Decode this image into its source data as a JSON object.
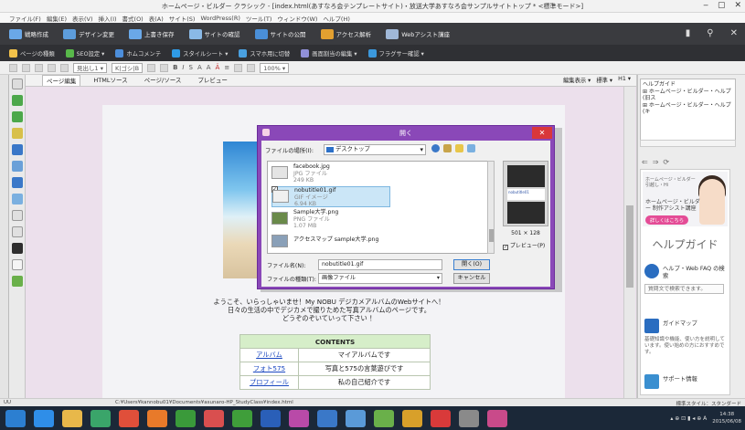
{
  "window": {
    "title": "ホームページ・ビルダー クラシック - [index.html(あすなろ会テンプレートサイト)・放送大学あすなろ会サンプルサイトトップ * <標準モード>]",
    "controls": [
      "‒",
      "▢",
      "✕"
    ]
  },
  "menubar": [
    "ファイル(F)",
    "編集(E)",
    "表示(V)",
    "挿入(I)",
    "書式(O)",
    "表(A)",
    "サイト(S)",
    "WordPress(R)",
    "ツール(T)",
    "ウィンドウ(W)",
    "ヘルプ(H)"
  ],
  "toolbar_main": {
    "items": [
      {
        "label": "戦略作成",
        "color": "#6aa8e8"
      },
      {
        "label": "デザイン変更",
        "color": "#5d9ddc"
      },
      {
        "label": "上書き保存",
        "color": "#6aa8e8"
      },
      {
        "label": "サイトの確認",
        "color": "#8ab9e6"
      },
      {
        "label": "サイトの公開",
        "color": "#4a8fd8"
      },
      {
        "label": "アクセス解析",
        "color": "#e3a030"
      },
      {
        "label": "Webアシスト講座",
        "color": "#a0b8d8"
      }
    ],
    "right_icons": [
      "▮",
      "⚲",
      "✕"
    ]
  },
  "toolbar_sub": {
    "items": [
      {
        "label": "ページの種類",
        "color": "#f1c14a"
      },
      {
        "label": "SEO設定 ▾",
        "color": "#58b84a"
      },
      {
        "label": "ホムコメンテ",
        "color": "#4c8edb"
      },
      {
        "label": "スタイルシート ▾",
        "color": "#2f9be6"
      },
      {
        "label": "スマホ用に切替",
        "color": "#49a0e0"
      },
      {
        "label": "画面割当の編集 ▾",
        "color": "#9090d8"
      },
      {
        "label": "フラグサー確認 ▾",
        "color": "#3b98dc"
      }
    ]
  },
  "format_bar": {
    "paragraph": "見出し1 ▾",
    "font": "K|ゴシ|B",
    "zoom": "100% ▾",
    "style_glyphs": [
      "B",
      "I",
      "S",
      "A",
      "A",
      "Ä",
      "≡"
    ]
  },
  "edit_tabs": {
    "tabs": [
      "ページ編集",
      "HTMLソース",
      "ページ/ソース",
      "プレビュー"
    ],
    "right": [
      "編集表示 ▾",
      "標準 ▾",
      "H1 ▾"
    ]
  },
  "page": {
    "welcome_lines": [
      "ようこそ、いらっしゃいませ！My NOBU デジカメアルバムのWebサイトへ！",
      "日々の生活の中でデジカメで撮りためた写真アルバムのページです。",
      "どうぞのぞいていって下さい ！"
    ],
    "contents_header": "CONTENTS",
    "contents_rows": [
      {
        "link": "アルバム",
        "desc": "マイアルバムです"
      },
      {
        "link": "フォト575",
        "desc": "写真と575の言葉遊びです"
      },
      {
        "link": "プロフィール",
        "desc": "私の自己紹介です"
      }
    ]
  },
  "dialog": {
    "title": "開く",
    "close": "✕",
    "look_in_label": "ファイルの場所(I):",
    "look_in_value": "デスクトップ",
    "files": [
      {
        "name": "facebook.jpg",
        "type": "JPG ファイル",
        "size": "249 KB",
        "selected": false,
        "checked": false
      },
      {
        "name": "nobutitle01.gif",
        "type": "GIF イメージ",
        "size": "6.94 KB",
        "selected": true,
        "checked": true
      },
      {
        "name": "Sample大学.png",
        "type": "PNG ファイル",
        "size": "1.07 MB",
        "selected": false,
        "checked": false
      },
      {
        "name": "アクセスマップ sample大学.png",
        "type": "",
        "size": "",
        "selected": false,
        "checked": false
      }
    ],
    "preview_size": "501 × 128",
    "preview_check_label": "プレビュー(P)",
    "preview_text": "nobutitle01",
    "filename_label": "ファイル名(N):",
    "filename_value": "nobutitle01.gif",
    "filetype_label": "ファイルの種類(T):",
    "filetype_value": "画像ファイル",
    "open_button": "開く(O)",
    "cancel_button": "キャンセル"
  },
  "right_panel": {
    "tree_lines": [
      "ヘルプガイド",
      "⊞ ホームページ・ビルダー・ヘルプ(旧ス",
      "⊞ ホームページ・ビルダー・ヘルプ(キ"
    ],
    "nav": [
      "⇐",
      "⇒",
      "⟳"
    ],
    "banner_small": "ホームページ・ビルダー 引越し・Hi",
    "banner_main": "ホームページ・ビルダー 制作アシスト講座",
    "banner_button": "詳しくはこちら",
    "help_title": "ヘルプガイド",
    "sections": [
      {
        "label": "ヘルプ・Web FAQ の検索",
        "box": "質問文で検索できます。",
        "color": "#2a6dc0"
      },
      {
        "label": "ガイドマップ",
        "desc": "基礎知識や機能、使い方を説明しています。使い始めの方におすすめです。",
        "color": "#2a6dc0"
      },
      {
        "label": "サポート情報",
        "color": "#3a8fd0"
      }
    ]
  },
  "statusbar": {
    "left": "UU",
    "path": "C:¥Users¥kannobu01¥Documents¥asunaro-HP_StudyClass¥index.html",
    "mode": "標準スタイル：スタンダード"
  },
  "taskbar": {
    "apps": [
      {
        "name": "start",
        "color": "#2c7fd1"
      },
      {
        "name": "ie",
        "color": "#2f8ee8"
      },
      {
        "name": "explorer",
        "color": "#e8b84a"
      },
      {
        "name": "store",
        "color": "#3aa56a"
      },
      {
        "name": "media",
        "color": "#e04f3a"
      },
      {
        "name": "firefox",
        "color": "#e87a2a"
      },
      {
        "name": "chrome",
        "color": "#3a9a3a"
      },
      {
        "name": "tool1",
        "color": "#d94f4f"
      },
      {
        "name": "dw",
        "color": "#3f9e3a"
      },
      {
        "name": "ps",
        "color": "#2a5fb8"
      },
      {
        "name": "hpb",
        "color": "#b94aa8"
      },
      {
        "name": "tool2",
        "color": "#3a78c8"
      },
      {
        "name": "tool3",
        "color": "#5a9ad8"
      },
      {
        "name": "tool4",
        "color": "#6ab04a"
      },
      {
        "name": "tool5",
        "color": "#d8a02a"
      },
      {
        "name": "tool6",
        "color": "#d93a3a"
      },
      {
        "name": "tool7",
        "color": "#8a8a8a"
      },
      {
        "name": "tool8",
        "color": "#c94a8a"
      }
    ],
    "tray": "▴ ⊕ ⊡ ▮ ◂ ⊕ A",
    "time": "14:38",
    "date": "2015/06/08"
  }
}
